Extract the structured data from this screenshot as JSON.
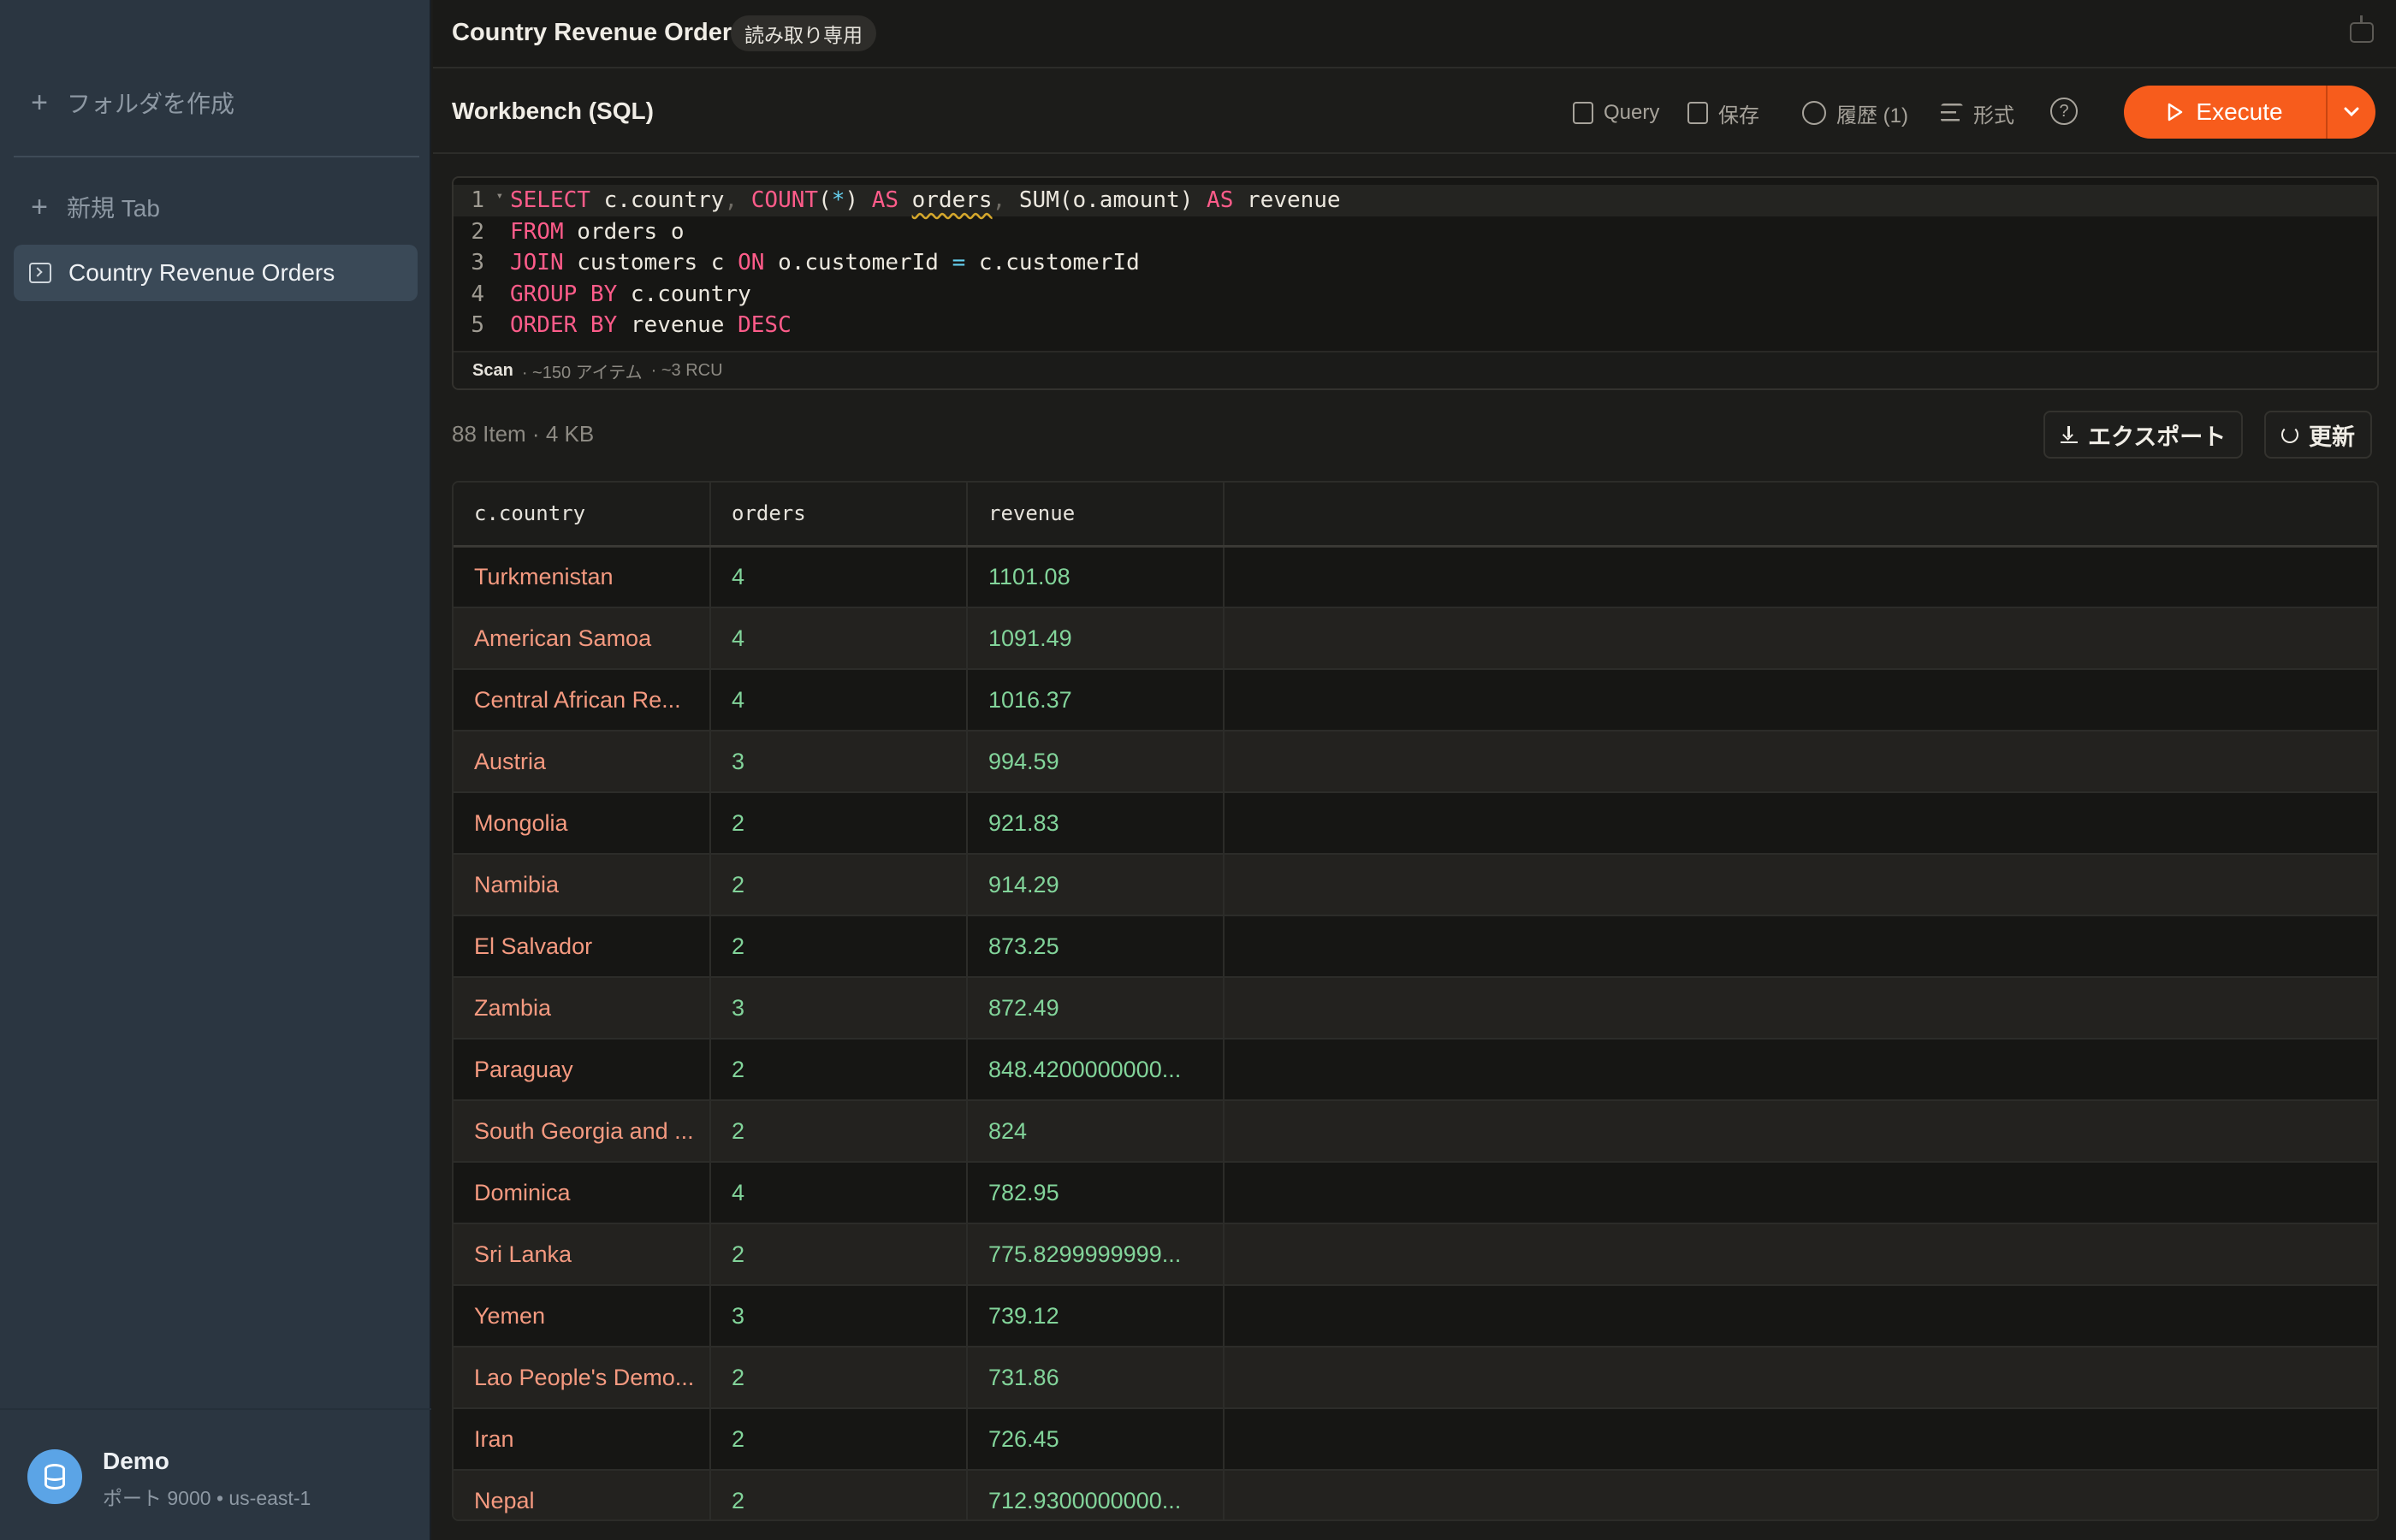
{
  "sidebar": {
    "create_folder": "フォルダを作成",
    "new_tab": "新規 Tab",
    "active_item": "Country Revenue Orders",
    "connection": {
      "name": "Demo",
      "details": "ポート 9000 • us-east-1"
    }
  },
  "topbar": {
    "title": "Country Revenue Orders",
    "badge": "読み取り専用"
  },
  "toolbar": {
    "title": "Workbench (SQL)",
    "query": "Query",
    "save": "保存",
    "history": "履歴 (1)",
    "format": "形式",
    "help": "?",
    "execute": "Execute"
  },
  "editor": {
    "line_numbers": [
      "1",
      "2",
      "3",
      "4",
      "5"
    ],
    "footer": {
      "mode": "Scan",
      "items": "· ~150 アイテム",
      "rcu": "· ~3 RCU"
    }
  },
  "results": {
    "meta": "88 Item  ·  4 KB",
    "export": "エクスポート",
    "refresh": "更新",
    "columns": [
      "c.country",
      "orders",
      "revenue"
    ],
    "rows": [
      [
        "Turkmenistan",
        "4",
        "1101.08"
      ],
      [
        "American Samoa",
        "4",
        "1091.49"
      ],
      [
        "Central African Re...",
        "4",
        "1016.37"
      ],
      [
        "Austria",
        "3",
        "994.59"
      ],
      [
        "Mongolia",
        "2",
        "921.83"
      ],
      [
        "Namibia",
        "2",
        "914.29"
      ],
      [
        "El Salvador",
        "2",
        "873.25"
      ],
      [
        "Zambia",
        "3",
        "872.49"
      ],
      [
        "Paraguay",
        "2",
        "848.4200000000..."
      ],
      [
        "South Georgia and ...",
        "2",
        "824"
      ],
      [
        "Dominica",
        "4",
        "782.95"
      ],
      [
        "Sri Lanka",
        "2",
        "775.8299999999..."
      ],
      [
        "Yemen",
        "3",
        "739.12"
      ],
      [
        "Lao People's Demo...",
        "2",
        "731.86"
      ],
      [
        "Iran",
        "2",
        "726.45"
      ],
      [
        "Nepal",
        "2",
        "712.9300000000..."
      ]
    ]
  },
  "colors": {
    "accent": "#f75c1c",
    "sidebar_bg": "#2b3641",
    "country_text": "#f59a80",
    "number_text": "#82d49a",
    "sql_keyword": "#ff5c8a"
  }
}
